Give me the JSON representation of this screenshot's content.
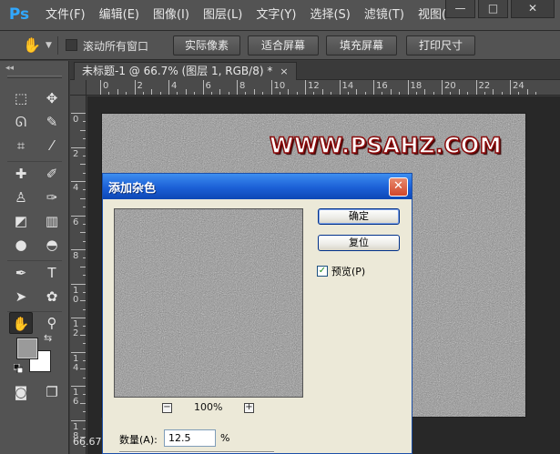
{
  "app": {
    "logo": "Ps"
  },
  "menu": {
    "items": [
      "文件(F)",
      "编辑(E)",
      "图像(I)",
      "图层(L)",
      "文字(Y)",
      "选择(S)",
      "滤镜(T)",
      "视图("
    ]
  },
  "window_controls": {
    "minimize": "—",
    "maximize": "□",
    "close": "✕"
  },
  "options_bar": {
    "tool_icon": "hand-icon",
    "scroll_all_windows_label": "滚动所有窗口",
    "scroll_all_windows_checked": false,
    "buttons": [
      "实际像素",
      "适合屏幕",
      "填充屏幕",
      "打印尺寸"
    ]
  },
  "toolbar": {
    "collapse_glyph": "◂◂",
    "tools": [
      "marquee-icon",
      "move-icon",
      "lasso-icon",
      "quick-selection-icon",
      "crop-icon",
      "eyedropper-icon",
      "healing-brush-icon",
      "brush-icon",
      "clone-stamp-icon",
      "history-brush-icon",
      "eraser-icon",
      "gradient-icon",
      "blur-icon",
      "dodge-icon",
      "pen-icon",
      "type-icon",
      "path-selection-icon",
      "shape-icon",
      "hand-icon",
      "zoom-icon"
    ],
    "active_tool": "hand-icon",
    "foreground_color": "#9a9a9a",
    "background_color": "#ffffff"
  },
  "document": {
    "tab_title": "未标题-1 @ 66.7% (图层 1, RGB/8) *",
    "tab_close": "×",
    "zoom_status": "66.67",
    "watermark": "WWW.PSAHZ.COM"
  },
  "rulers": {
    "horizontal": [
      "0",
      "2",
      "4",
      "6",
      "8",
      "10",
      "12",
      "14",
      "16",
      "18",
      "20",
      "22",
      "24"
    ],
    "vertical": [
      "0",
      "2",
      "4",
      "6",
      "8",
      "1 0",
      "1 2",
      "1 4",
      "1 6",
      "1 8"
    ]
  },
  "dialog": {
    "title": "添加杂色",
    "close": "✕",
    "ok_label": "确定",
    "reset_label": "复位",
    "preview_label": "预览(P)",
    "preview_checked": true,
    "zoom_minus": "−",
    "zoom_plus": "+",
    "zoom_value": "100%",
    "amount_label": "数量(A):",
    "amount_value": "12.5",
    "amount_unit": "%"
  },
  "colors": {
    "ps_blue": "#31a8ff",
    "dialog_title": "#1b5fd6",
    "watermark_stroke": "#8a0b0b"
  }
}
